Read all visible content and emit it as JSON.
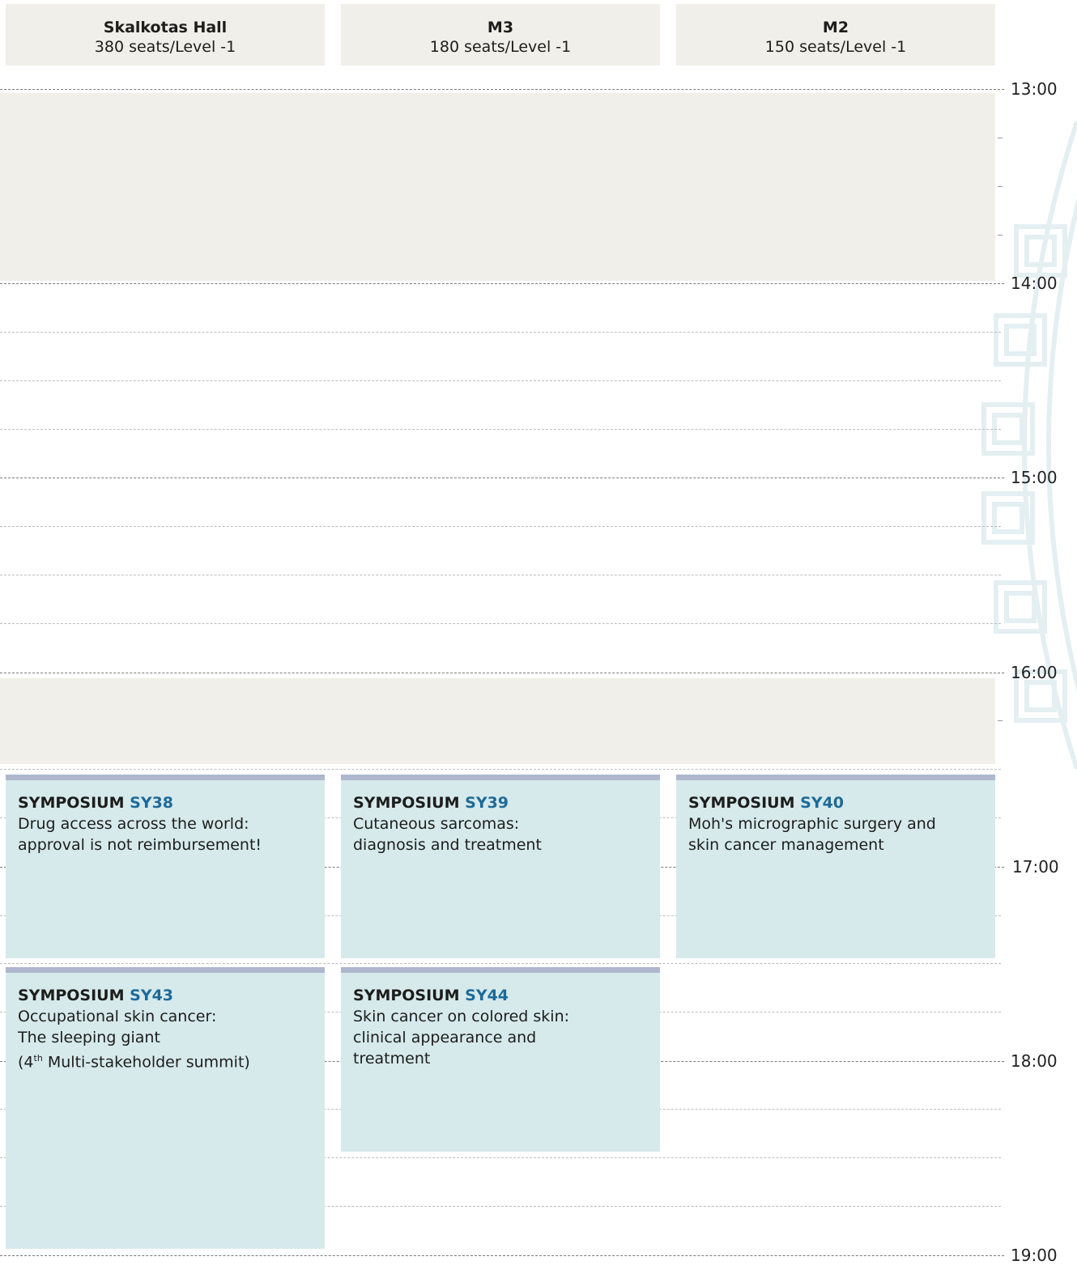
{
  "rooms": [
    {
      "name": "Skalkotas Hall",
      "capacity": "380 seats/Level -1"
    },
    {
      "name": "M3",
      "capacity": "180 seats/Level -1"
    },
    {
      "name": "M2",
      "capacity": "150 seats/Level -1"
    }
  ],
  "times": [
    "13:00",
    "14:00",
    "15:00",
    "16:00",
    "17:00",
    "18:00",
    "19:00"
  ],
  "sessions": [
    {
      "type": "SYMPOSIUM",
      "code": "SY38",
      "title_lines": [
        "Drug access across the world:",
        "approval is not reimbursement!"
      ]
    },
    {
      "type": "SYMPOSIUM",
      "code": "SY39",
      "title_lines": [
        "Cutaneous sarcomas:",
        "diagnosis and treatment"
      ]
    },
    {
      "type": "SYMPOSIUM",
      "code": "SY40",
      "title_lines": [
        "Moh's micrographic surgery and",
        "skin cancer management"
      ]
    },
    {
      "type": "SYMPOSIUM",
      "code": "SY43",
      "title_lines": [
        "Occupational skin cancer:",
        "The sleeping giant"
      ],
      "title_extra": {
        "prefix": "(4",
        "superscript": "th",
        "suffix": " Multi-stakeholder summit)"
      }
    },
    {
      "type": "SYMPOSIUM",
      "code": "SY44",
      "title_lines": [
        "Skin cancer on colored skin:",
        "clinical appearance and",
        "treatment"
      ]
    }
  ],
  "colors": {
    "header_bg": "#f0efea",
    "session_bg": "#d6eaec",
    "session_top_bar": "#adb8ce",
    "code_blue": "#1e6a97"
  }
}
